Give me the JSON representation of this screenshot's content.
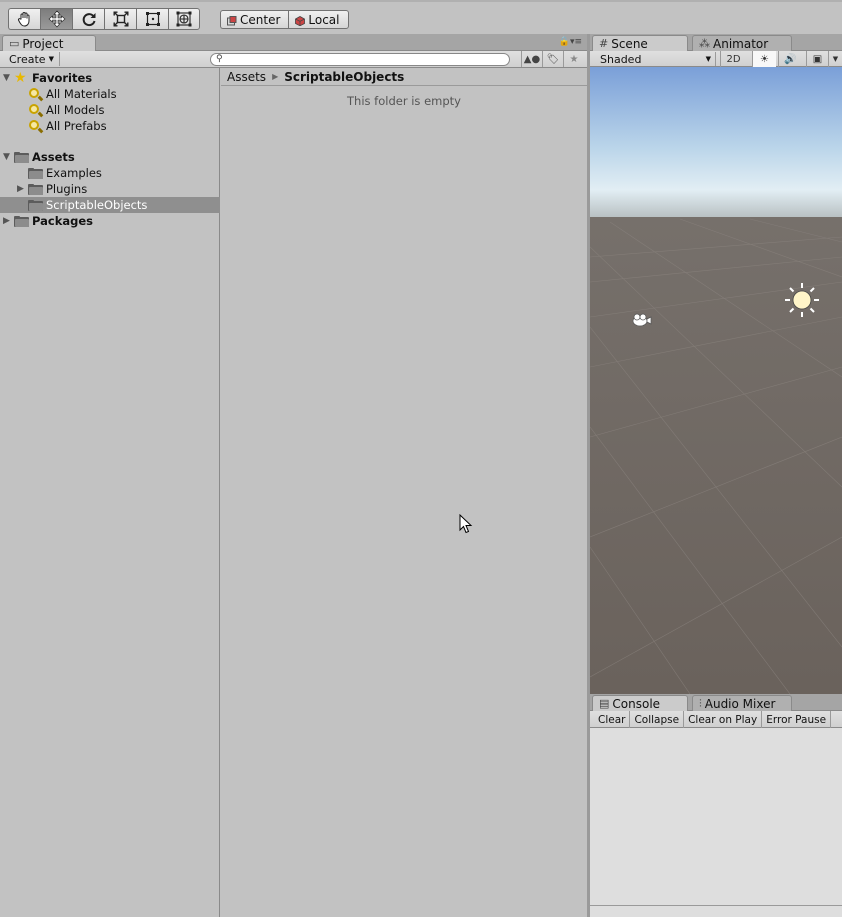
{
  "toolbar": {
    "tools": [
      "hand-tool",
      "move-tool",
      "rotate-tool",
      "scale-tool",
      "rect-tool",
      "transform-tool"
    ],
    "active_tool": "move-tool",
    "pivot_label": "Center",
    "space_label": "Local"
  },
  "project": {
    "tab_label": "Project",
    "create_label": "Create",
    "search_placeholder": "",
    "tree": {
      "favorites_label": "Favorites",
      "favorites": [
        "All Materials",
        "All Models",
        "All Prefabs"
      ],
      "assets_label": "Assets",
      "assets_children": [
        "Examples",
        "Plugins",
        "ScriptableObjects"
      ],
      "selected": "ScriptableObjects",
      "packages_label": "Packages"
    },
    "breadcrumb": [
      "Assets",
      "ScriptableObjects"
    ],
    "empty_message": "This folder is empty"
  },
  "scene": {
    "tab_label": "Scene",
    "animator_tab_label": "Animator",
    "shading_mode": "Shaded",
    "mode_2d_label": "2D"
  },
  "console": {
    "tab_label": "Console",
    "audio_mixer_tab_label": "Audio Mixer",
    "buttons": [
      "Clear",
      "Collapse",
      "Clear on Play",
      "Error Pause"
    ]
  }
}
